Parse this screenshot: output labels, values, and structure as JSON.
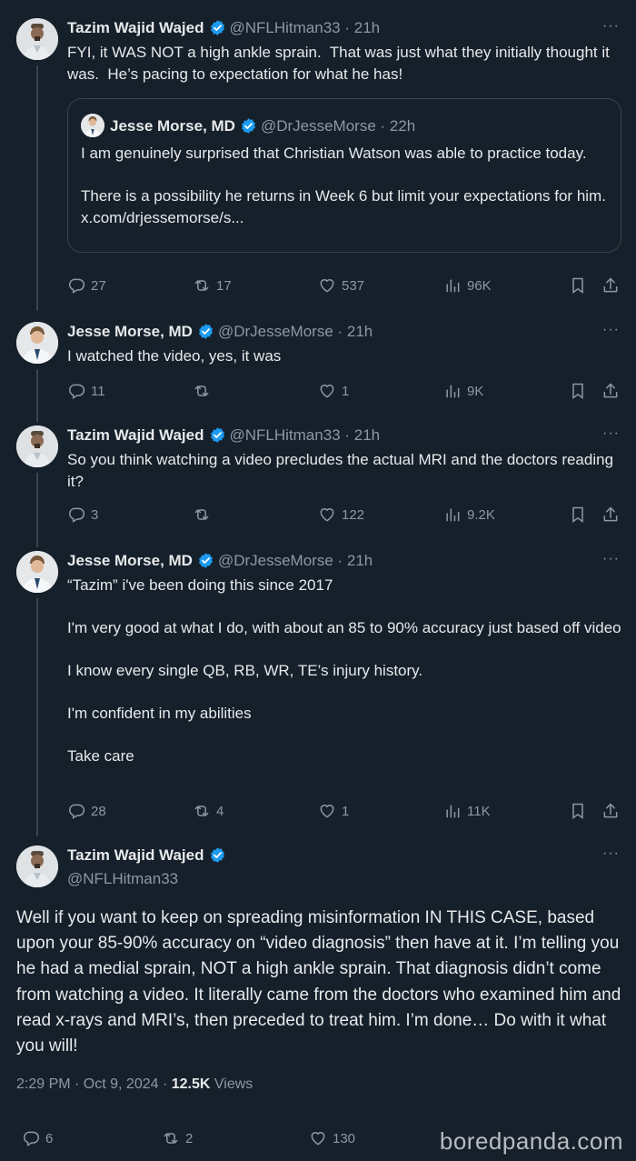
{
  "colors": {
    "background": "#15202b",
    "text": "#e7e9ea",
    "muted": "#8b98a5",
    "verified": "#1d9bf0",
    "border": "#38444d"
  },
  "icons": {
    "reply": "reply-icon",
    "retweet": "retweet-icon",
    "like": "heart-icon",
    "views": "views-icon",
    "bookmark": "bookmark-icon",
    "share": "share-icon",
    "more": "more-icon",
    "verified": "verified-badge-icon"
  },
  "tweets": [
    {
      "name": "Tazim Wajid Wajed",
      "handle": "@NFLHitman33 · 21h",
      "text": "FYI, it WAS NOT a high ankle sprain.  That was just what they initially thought it was.  He’s pacing to expectation for what he has!",
      "quote": {
        "name": "Jesse Morse, MD",
        "handle": "@DrJesseMorse · 22h",
        "text": "I am genuinely surprised that Christian Watson was able to practice today.\n\nThere is a possibility he returns in Week 6 but limit your expectations for him. x.com/drjessemorse/s..."
      },
      "replies": "27",
      "retweets": "17",
      "likes": "537",
      "views": "96K"
    },
    {
      "name": "Jesse Morse, MD",
      "handle": "@DrJesseMorse · 21h",
      "text": "I watched the video, yes, it was",
      "replies": "11",
      "retweets": "",
      "likes": "1",
      "views": "9K"
    },
    {
      "name": "Tazim Wajid Wajed",
      "handle": "@NFLHitman33 · 21h",
      "text": "So you think watching a video precludes the actual MRI and the doctors reading it?",
      "replies": "3",
      "retweets": "",
      "likes": "122",
      "views": "9.2K"
    },
    {
      "name": "Jesse Morse, MD",
      "handle": "@DrJesseMorse · 21h",
      "text": "“Tazim” i've been doing this since 2017\n\nI'm very good at what I do, with about an 85 to 90% accuracy just based off video\n\nI know every single QB, RB, WR, TE’s injury history.\n\nI'm confident in my abilities\n\nTake care",
      "replies": "28",
      "retweets": "4",
      "likes": "1",
      "views": "11K"
    }
  ],
  "main_tweet": {
    "name": "Tazim Wajid Wajed",
    "handle": "@NFLHitman33",
    "text": "Well if you want to keep on spreading misinformation IN THIS CASE, based upon your 85-90% accuracy on “video diagnosis” then have at it.  I’m telling you he had a medial sprain, NOT a high ankle sprain.  That diagnosis didn’t come from watching a video.  It literally came from the doctors who examined him and read x-rays and MRI’s, then preceded to treat him.  I’m done… Do with it what you will!",
    "time": "2:29 PM · Oct 9, 2024 · ",
    "views_count": "12.5K",
    "views_label": " Views",
    "replies": "6",
    "retweets": "2",
    "likes": "130"
  },
  "watermark": "boredpanda.com"
}
